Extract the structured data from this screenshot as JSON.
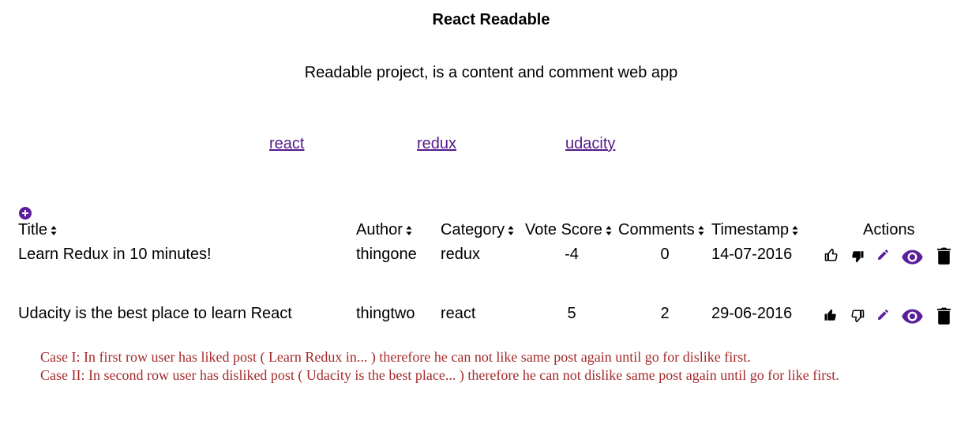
{
  "header": {
    "title": "React Readable",
    "subtitle": "Readable project, is a content and comment web app"
  },
  "categories": [
    {
      "label": "react"
    },
    {
      "label": "redux"
    },
    {
      "label": "udacity"
    }
  ],
  "table": {
    "columns": {
      "title": "Title",
      "author": "Author",
      "category": "Category",
      "vote_score": "Vote Score",
      "comments": "Comments",
      "timestamp": "Timestamp",
      "actions": "Actions"
    },
    "rows": [
      {
        "title": "Learn Redux in 10 minutes!",
        "author": "thingone",
        "category": "redux",
        "vote_score": "-4",
        "comments": "0",
        "timestamp": "14-07-2016",
        "upvote_state": "inactive",
        "downvote_state": "active"
      },
      {
        "title": "Udacity is the best place to learn React",
        "author": "thingtwo",
        "category": "react",
        "vote_score": "5",
        "comments": "2",
        "timestamp": "29-06-2016",
        "upvote_state": "active",
        "downvote_state": "inactive"
      }
    ]
  },
  "notes": [
    "Case I: In first row user has liked post ( Learn Redux in... ) therefore he can not like same post again until go for dislike first.",
    "Case II: In second row user has disliked post ( Udacity is the best place... ) therefore he can not dislike same post again until go for like first."
  ],
  "icons": {
    "add": "plus-circle-icon",
    "sort": "sort-icon",
    "upvote": "thumbs-up-icon",
    "downvote": "thumbs-down-icon",
    "edit": "pencil-icon",
    "view": "eye-icon",
    "delete": "trash-icon"
  },
  "colors": {
    "accent": "#5b1f9b",
    "link": "#551a8b",
    "note": "#a52a2a",
    "icon_dark": "#000000"
  }
}
